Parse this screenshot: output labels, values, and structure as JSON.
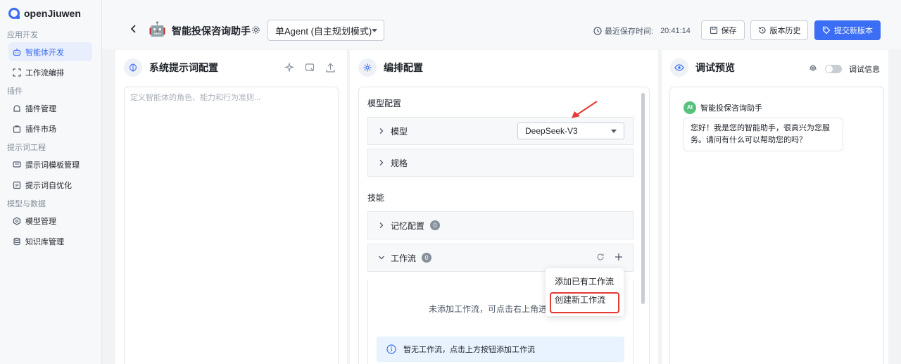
{
  "brand": {
    "name": "openJiuwen"
  },
  "sidebar": {
    "sections": [
      {
        "title": "应用开发",
        "items": [
          {
            "label": "智能体开发",
            "icon": "robot-icon",
            "active": true
          },
          {
            "label": "工作流编排",
            "icon": "workflow-icon"
          }
        ]
      },
      {
        "title": "插件",
        "items": [
          {
            "label": "插件管理",
            "icon": "plugin-icon"
          },
          {
            "label": "插件市场",
            "icon": "market-icon"
          }
        ]
      },
      {
        "title": "提示词工程",
        "items": [
          {
            "label": "提示词模板管理",
            "icon": "template-icon"
          },
          {
            "label": "提示词自优化",
            "icon": "optimize-icon"
          }
        ]
      },
      {
        "title": "模型与数据",
        "items": [
          {
            "label": "模型管理",
            "icon": "model-icon"
          },
          {
            "label": "知识库管理",
            "icon": "database-icon"
          }
        ]
      }
    ]
  },
  "header": {
    "agent_title": "智能投保咨询助手",
    "mode": "单Agent (自主规划模式)",
    "save_time_label": "最近保存时间:",
    "save_time": "20:41:14",
    "save_btn": "保存",
    "history_btn": "版本历史",
    "submit_btn": "提交新版本"
  },
  "prompt_panel": {
    "title": "系统提示词配置",
    "placeholder": "定义智能体的角色、能力和行为准则..."
  },
  "config_panel": {
    "title": "编排配置",
    "model_group": "模型配置",
    "model_label": "模型",
    "model_value": "DeepSeek-V3",
    "spec_label": "规格",
    "skills_group": "技能",
    "memory_label": "记忆配置",
    "memory_count": "0",
    "workflow_label": "工作流",
    "workflow_count": "0",
    "workflow_empty": "未添加工作流，可点击右上角进",
    "info_text": "暂无工作流，点击上方按钮添加工作流"
  },
  "popup": {
    "add_existing": "添加已有工作流",
    "create_new": "创建新工作流"
  },
  "preview_panel": {
    "title": "调试预览",
    "debug_label": "调试信息",
    "ai_avatar": "AI",
    "ai_name": "智能投保咨询助手",
    "greeting": "您好！我是您的智能助手，很高兴为您服务。请问有什么可以帮助您的吗？"
  },
  "colors": {
    "accent": "#3b6ef5",
    "highlight": "#e53935"
  }
}
